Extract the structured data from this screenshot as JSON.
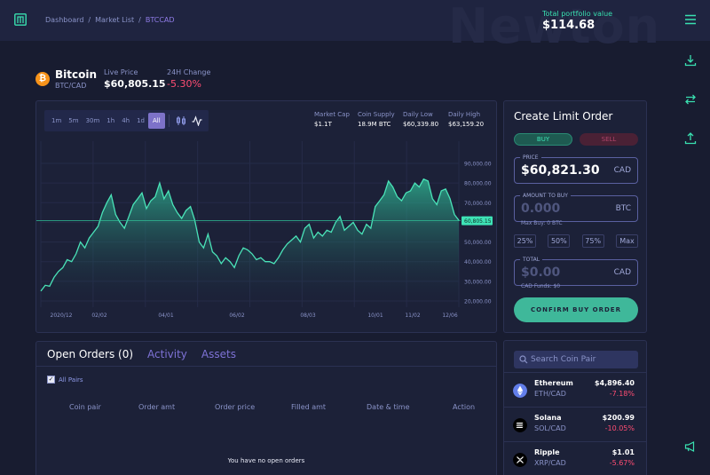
{
  "header": {
    "breadcrumb": [
      "Dashboard",
      "Market List",
      "BTCCAD"
    ],
    "watermark": "Newton",
    "portfolio_label": "Total portfolio value",
    "portfolio_value": "$114.68"
  },
  "coin": {
    "name": "Bitcoin",
    "pair": "BTC/CAD",
    "live_label": "Live Price",
    "live_value": "$60,805.15",
    "change_label": "24H Change",
    "change_value": "-5.30%",
    "icon_glyph": "₿"
  },
  "timeframes": [
    "1m",
    "5m",
    "30m",
    "1h",
    "4h",
    "1d",
    "All"
  ],
  "active_timeframe": "All",
  "stats": [
    {
      "label": "Market Cap",
      "value": "$1.1T"
    },
    {
      "label": "Coin Supply",
      "value": "18.9M BTC"
    },
    {
      "label": "Daily Low",
      "value": "$60,339.80"
    },
    {
      "label": "Daily High",
      "value": "$63,159.20"
    }
  ],
  "chart_data": {
    "type": "area",
    "x_tick_labels": [
      "2020/12",
      "02/02",
      "04/01",
      "06/02",
      "08/03",
      "10/01",
      "11/02",
      "12/06"
    ],
    "y_tick_labels": [
      "90,000.00",
      "80,000.00",
      "70,000.00",
      "60,000.00",
      "50,000.00",
      "40,000.00",
      "30,000.00",
      "20,000.00"
    ],
    "ylim": [
      20000,
      90000
    ],
    "current_price_label": "60,805.15",
    "current_price": 60805.15,
    "values": [
      25000,
      28000,
      27500,
      32000,
      35000,
      37000,
      41000,
      40000,
      44000,
      50000,
      47000,
      52000,
      55000,
      58000,
      65000,
      70000,
      74000,
      64000,
      60000,
      57000,
      63000,
      69000,
      72000,
      75000,
      67000,
      71000,
      73000,
      80000,
      72000,
      76000,
      69000,
      65000,
      62000,
      66000,
      68000,
      61000,
      50000,
      47000,
      54000,
      45000,
      43000,
      39000,
      42000,
      40000,
      37000,
      43000,
      47000,
      46000,
      44000,
      41000,
      42000,
      40000,
      40000,
      39000,
      42000,
      46000,
      49000,
      51000,
      53000,
      50000,
      57000,
      59000,
      52000,
      55000,
      53000,
      56000,
      55000,
      60000,
      63000,
      56000,
      58000,
      60000,
      56000,
      54000,
      59000,
      57000,
      68000,
      71000,
      74000,
      81000,
      78000,
      73000,
      71000,
      75000,
      76000,
      80000,
      78000,
      82000,
      81000,
      72000,
      69000,
      76000,
      77000,
      72000,
      64000,
      61000
    ]
  },
  "orders": {
    "tabs": [
      "Open Orders (0)",
      "Activity",
      "Assets"
    ],
    "all_pairs_label": "All Pairs",
    "columns": [
      "Coin pair",
      "Order amt",
      "Order price",
      "Filled amt",
      "Date & time",
      "Action"
    ],
    "empty_message": "You have no open orders"
  },
  "limit_order": {
    "title": "Create Limit Order",
    "buy_label": "BUY",
    "sell_label": "SELL",
    "price_label": "PRICE",
    "price_value": "$60,821.30",
    "price_unit": "CAD",
    "amount_label": "AMOUNT TO BUY",
    "amount_value": "0.000",
    "amount_unit": "BTC",
    "max_buy": "Max Buy: 0 BTC",
    "percents": [
      "25%",
      "50%",
      "75%",
      "Max"
    ],
    "total_label": "TOTAL",
    "total_value": "$0.00",
    "total_unit": "CAD",
    "funds": "CAD Funds: $0",
    "confirm_label": "CONFIRM BUY ORDER"
  },
  "coin_list": {
    "search_placeholder": "Search Coin Pair",
    "items": [
      {
        "name": "Ethereum",
        "pair": "ETH/CAD",
        "price": "$4,896.40",
        "change": "-7.18%",
        "color": "#627eea"
      },
      {
        "name": "Solana",
        "pair": "SOL/CAD",
        "price": "$200.99",
        "change": "-10.05%",
        "color": "#000000"
      },
      {
        "name": "Ripple",
        "pair": "XRP/CAD",
        "price": "$1.01",
        "change": "-5.67%",
        "color": "#23292f"
      }
    ]
  }
}
